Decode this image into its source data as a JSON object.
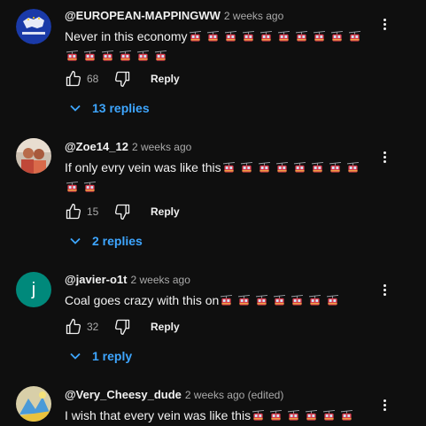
{
  "colors": {
    "background": "#0f0f0f",
    "text": "#f1f1f1",
    "muted": "#aaaaaa",
    "link": "#3ea6ff"
  },
  "reply_label": "Reply",
  "comments": [
    {
      "handle": "@EUROPEAN-MAPPINGWW",
      "time": "2 weeks ago",
      "text": "Never in this economy",
      "emoji_icon": "aerial-tramway-icon",
      "emoji_count": 16,
      "likes": "68",
      "replies_label": "13 replies",
      "avatar": {
        "type": "logo",
        "text": "EUROPE MAPPING",
        "color": "#1a3aa8"
      }
    },
    {
      "handle": "@Zoe14_12",
      "time": "2 weeks ago",
      "text": "If only evry vein was like this",
      "emoji_icon": "aerial-tramway-icon",
      "emoji_count": 10,
      "likes": "15",
      "replies_label": "2 replies",
      "avatar": {
        "type": "photo",
        "color": "#7a4a3a"
      }
    },
    {
      "handle": "@javier-o1t",
      "time": "2 weeks ago",
      "text": "Coal goes crazy with this on",
      "emoji_icon": "aerial-tramway-icon",
      "emoji_count": 7,
      "likes": "32",
      "replies_label": "1 reply",
      "avatar": {
        "type": "letter",
        "letter": "j",
        "color": "#00897b"
      }
    },
    {
      "handle": "@Very_Cheesy_dude",
      "time": "2 weeks ago (edited)",
      "text": "I wish that every vein was like this",
      "emoji_icon": "aerial-tramway-icon",
      "emoji_count": 6,
      "avatar": {
        "type": "drawing",
        "color": "#c9c2a0"
      }
    }
  ]
}
